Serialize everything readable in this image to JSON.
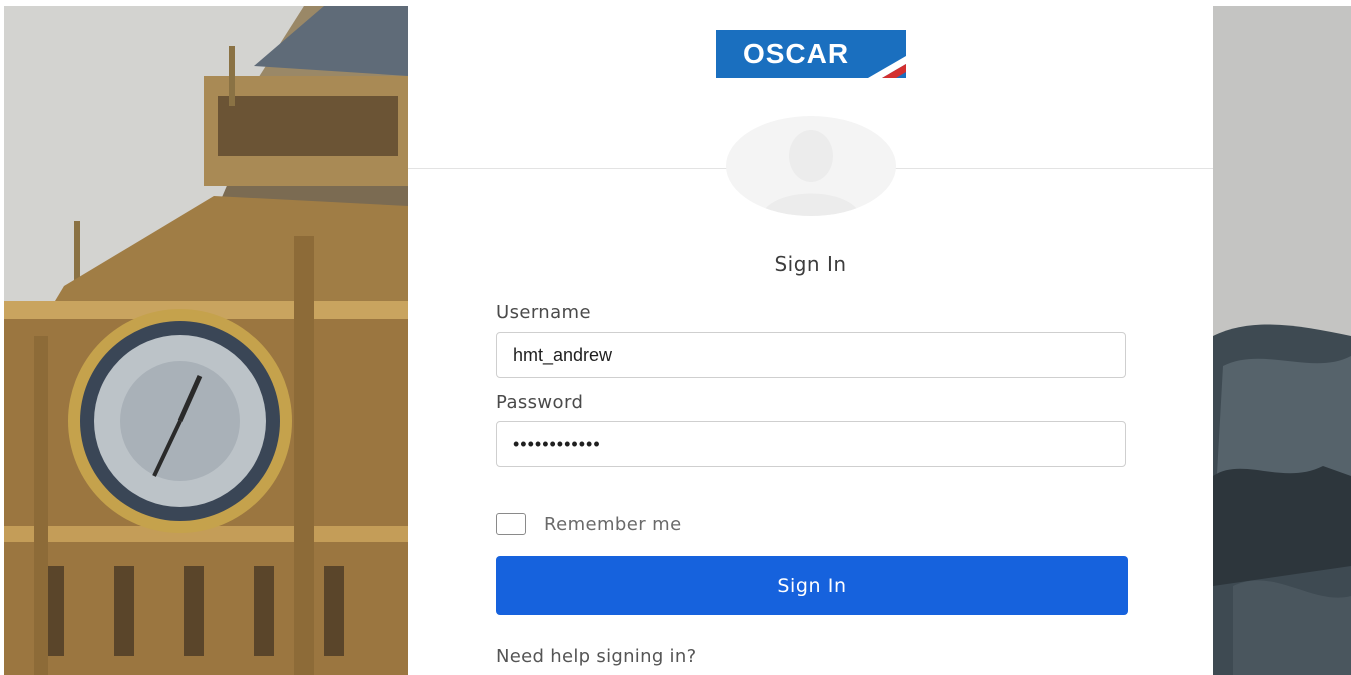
{
  "logo": {
    "text": "OSCAR",
    "brand_color": "#1a6fbf",
    "stripe_color": "#d32f2f"
  },
  "avatar": {
    "icon": "user-silhouette-icon"
  },
  "form": {
    "title": "Sign In",
    "username_label": "Username",
    "username_value": "hmt_andrew",
    "password_label": "Password",
    "password_value": "••••••••••••",
    "remember_label": "Remember me",
    "remember_checked": false,
    "submit_label": "Sign In",
    "submit_color": "#1662dd",
    "help_link": "Need help signing in?"
  },
  "background": {
    "left_image": "clock-tower-photo",
    "right_image": "statue-photo"
  }
}
